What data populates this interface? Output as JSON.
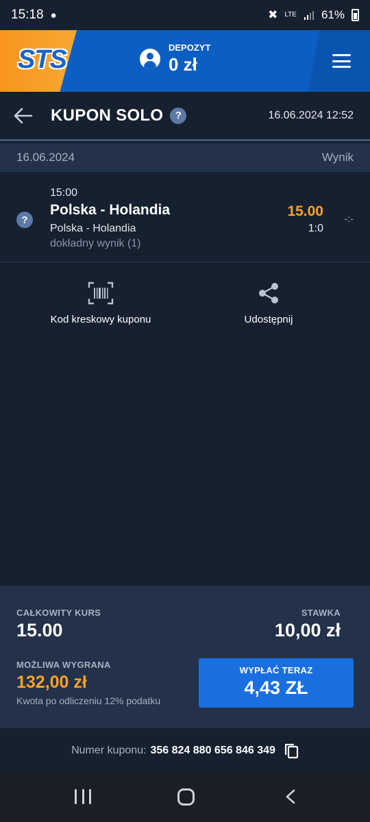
{
  "status_bar": {
    "time": "15:18",
    "battery": "61%",
    "network": "LTE"
  },
  "header": {
    "logo": "STS",
    "deposit_label": "DEPOZYT",
    "deposit_value": "0 zł"
  },
  "title_bar": {
    "title": "KUPON SOLO",
    "help": "?",
    "datetime": "16.06.2024 12:52"
  },
  "date_row": {
    "date": "16.06.2024",
    "result_label": "Wynik"
  },
  "bet": {
    "help": "?",
    "time": "15:00",
    "event": "Polska - Holandia",
    "event_sub": "Polska - Holandia",
    "market": "dokładny wynik (1)",
    "odds": "15.00",
    "pick": "1:0",
    "score": "-:-"
  },
  "actions": {
    "barcode_label": "Kod kreskowy kuponu",
    "share_label": "Udostępnij"
  },
  "summary": {
    "total_odds_label": "CAŁKOWITY KURS",
    "total_odds": "15.00",
    "stake_label": "STAWKA",
    "stake": "10,00 zł",
    "possible_win_label": "MOŻLIWA WYGRANA",
    "possible_win": "132,00 zł",
    "tax_note": "Kwota po odliczeniu 12% podatku",
    "cashout_label": "WYPŁAĆ TERAZ",
    "cashout_value": "4,43 ZŁ"
  },
  "coupon": {
    "number_label": "Numer kuponu:",
    "number": "356 824 880 656 846 349"
  },
  "colors": {
    "background": "#16202f",
    "header_blue": "#0c5ec2",
    "accent_orange": "#f7a328",
    "cashout_blue": "#1a6fe0",
    "panel": "#23324a"
  },
  "icons": {
    "back": "arrow-left-icon",
    "barcode": "barcode-icon",
    "share": "share-icon",
    "copy": "copy-icon",
    "menu": "hamburger-menu-icon",
    "user": "user-icon"
  }
}
